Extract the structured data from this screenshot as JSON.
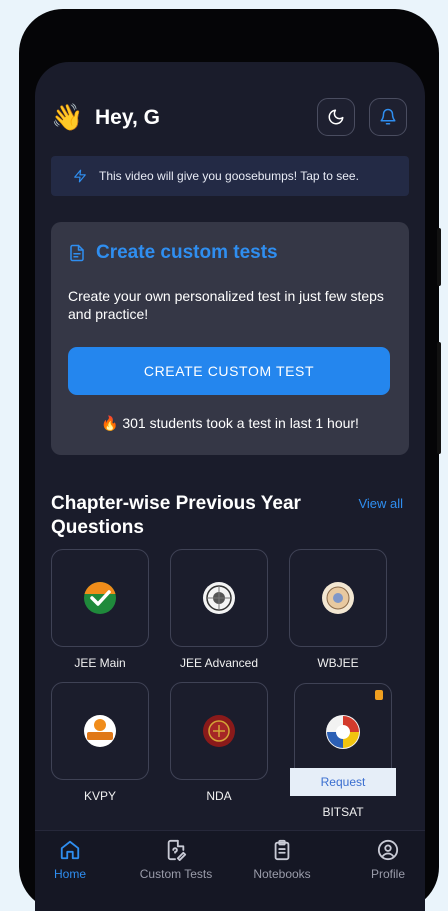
{
  "header": {
    "greeting": "Hey, G",
    "wave_emoji": "👋"
  },
  "banner": {
    "text": "This video will give you goosebumps! Tap to see."
  },
  "custom_card": {
    "title": "Create custom tests",
    "description": "Create your own personalized test in just few steps and practice!",
    "button_label": "CREATE CUSTOM TEST",
    "stat_emoji": "🔥",
    "stat_text": "301 students took a test in last 1 hour!"
  },
  "pyq": {
    "title": "Chapter-wise Previous Year Questions",
    "view_all": "View all",
    "exams": [
      {
        "label": "JEE Main"
      },
      {
        "label": "JEE Advanced"
      },
      {
        "label": "WBJEE"
      },
      {
        "label": "KVPY"
      },
      {
        "label": "NDA"
      },
      {
        "label": "BITSAT"
      }
    ],
    "request_label": "Request"
  },
  "nav": [
    {
      "label": "Home",
      "active": true
    },
    {
      "label": "Custom Tests"
    },
    {
      "label": "Notebooks"
    },
    {
      "label": "Profile"
    }
  ],
  "colors": {
    "accent": "#2f8ef0",
    "background": "#1a1c2b",
    "card": "#353746",
    "button": "#2486ee"
  }
}
